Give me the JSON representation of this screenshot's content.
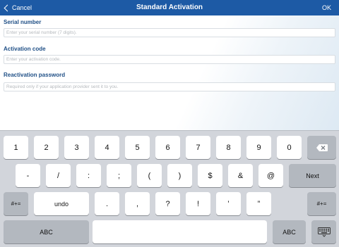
{
  "navbar": {
    "cancel_label": "Cancel",
    "title": "Standard Activation",
    "ok_label": "OK"
  },
  "form": {
    "serial_label": "Serial number",
    "serial_placeholder": "Enter your serial number (7 digits).",
    "activation_label": "Activation code",
    "activation_placeholder": "Enter your activation code.",
    "reactivation_label": "Reactivation password",
    "reactivation_placeholder": "Required only if your application provider sent it to you."
  },
  "keyboard": {
    "row1": [
      "1",
      "2",
      "3",
      "4",
      "5",
      "6",
      "7",
      "8",
      "9",
      "0"
    ],
    "backspace_icon": "backspace-icon",
    "row2": [
      "-",
      "/",
      ":",
      ";",
      "(",
      ")",
      "$",
      "&",
      "@"
    ],
    "next_label": "Next",
    "row3_left": "#+=",
    "undo_label": "undo",
    "row3": [
      ".",
      ",",
      "?",
      "!",
      "’",
      "”"
    ],
    "row3_right": "#+=",
    "abc_left": "ABC",
    "abc_right": "ABC",
    "hide_keyboard_icon": "keyboard-hide-icon"
  },
  "colors": {
    "navbar": "#1d5aa5",
    "label": "#1f4f86",
    "keyboard_bg": "#d2d5db",
    "key": "#ffffff",
    "key_gray": "#b3b8bf"
  }
}
